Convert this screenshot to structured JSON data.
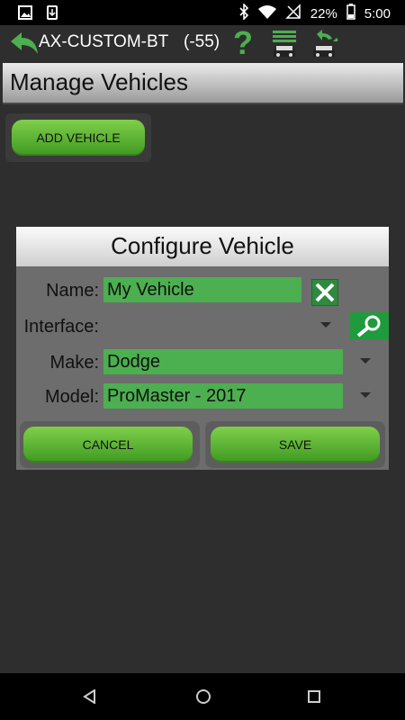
{
  "status_bar": {
    "battery": "22%",
    "time": "5:00",
    "icons": [
      "image-icon",
      "download-icon",
      "bluetooth-icon",
      "wifi-icon",
      "mute-icon",
      "battery-icon"
    ]
  },
  "app_bar": {
    "device_name": "AX-CUSTOM-BT",
    "signal": "(-55)",
    "help_glyph": "?"
  },
  "screen_title": "Manage Vehicles",
  "add_vehicle_label": "ADD VEHICLE",
  "dialog": {
    "title": "Configure Vehicle",
    "name_label": "Name:",
    "name_value": "My Vehicle",
    "interface_label": "Interface:",
    "interface_value": "",
    "make_label": "Make:",
    "make_value": "Dodge",
    "model_label": "Model:",
    "model_value": "ProMaster - 2017",
    "cancel_label": "CANCEL",
    "save_label": "SAVE"
  },
  "colors": {
    "accent_green": "#4caf50",
    "button_green": "#5fb336",
    "background": "#2e2e2e",
    "dialog_body": "#6d6d6d"
  }
}
